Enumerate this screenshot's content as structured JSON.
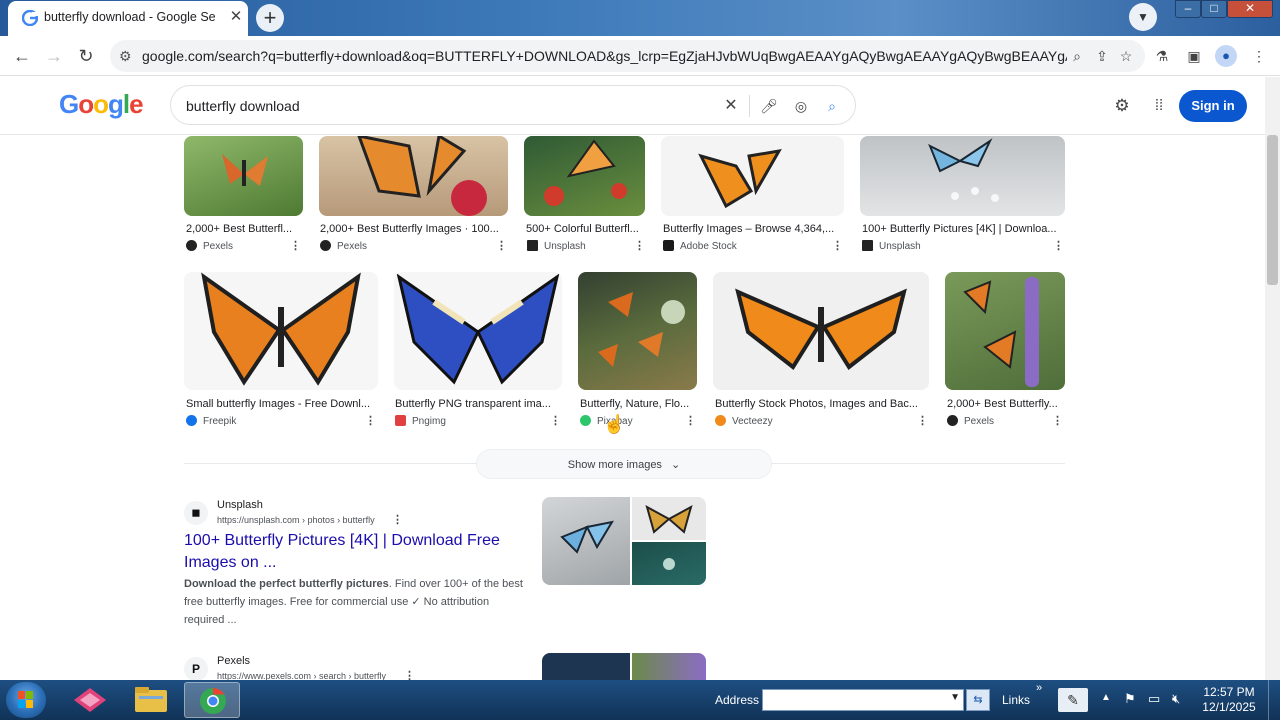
{
  "browser": {
    "tab_title": "butterfly download - Google Se",
    "url": "google.com/search?q=butterfly+download&oq=BUTTERFLY+DOWNLOAD&gs_lcrp=EgZjaHJvbWUqBwgAEAAYgAQyBwgAEAAYgAQyBwgBEAAYgA...",
    "new_tab": "+",
    "close_tab": "✕"
  },
  "google": {
    "logo": "Google",
    "query": "butterfly download",
    "sign_in": "Sign in",
    "show_more": "Show more images"
  },
  "images_row1": [
    {
      "caption": "2,000+ Best Butterfl...",
      "source": "Pexels",
      "color": "#5a8a3a"
    },
    {
      "caption": "2,000+ Best Butterfly Images · 100...",
      "source": "Pexels",
      "color": "#c9a274"
    },
    {
      "caption": "500+ Colorful Butterfl...",
      "source": "Unsplash",
      "color": "#3d6a3a"
    },
    {
      "caption": "Butterfly Images – Browse 4,364,...",
      "source": "Adobe Stock",
      "color": "#f2f2f2"
    },
    {
      "caption": "100+ Butterfly Pictures [4K] | Downloa...",
      "source": "Unsplash",
      "color": "#c6c9cc"
    }
  ],
  "images_row2": [
    {
      "caption": "Small butterfly Images - Free Downl...",
      "source": "Freepik",
      "color": "#f5f5f5"
    },
    {
      "caption": "Butterfly PNG transparent ima...",
      "source": "Pngimg",
      "color": "#f5f5f5"
    },
    {
      "caption": "Butterfly, Nature, Flo...",
      "source": "Pixabay",
      "color": "#4a5a3a"
    },
    {
      "caption": "Butterfly Stock Photos, Images and Bac...",
      "source": "Vecteezy",
      "color": "#f0f0f0"
    },
    {
      "caption": "2,000+ Best Butterfly...",
      "source": "Pexels",
      "color": "#6b8a4a"
    }
  ],
  "results": [
    {
      "site": "Unsplash",
      "url": "https://unsplash.com › photos › butterfly",
      "title_line1": "100+ Butterfly Pictures [4K] | Download Free",
      "title_line2": "Images on ...",
      "snippet_bold": "Download the perfect butterfly pictures",
      "snippet_rest": ". Find over 100+ of the best free butterfly images. Free for commercial use ✓ No attribution required ..."
    },
    {
      "site": "Pexels",
      "url": "https://www.pexels.com › search › butterfly"
    }
  ],
  "taskbar": {
    "address_label": "Address",
    "links_label": "Links",
    "time": "12:57 PM",
    "date": "12/1/2025"
  }
}
